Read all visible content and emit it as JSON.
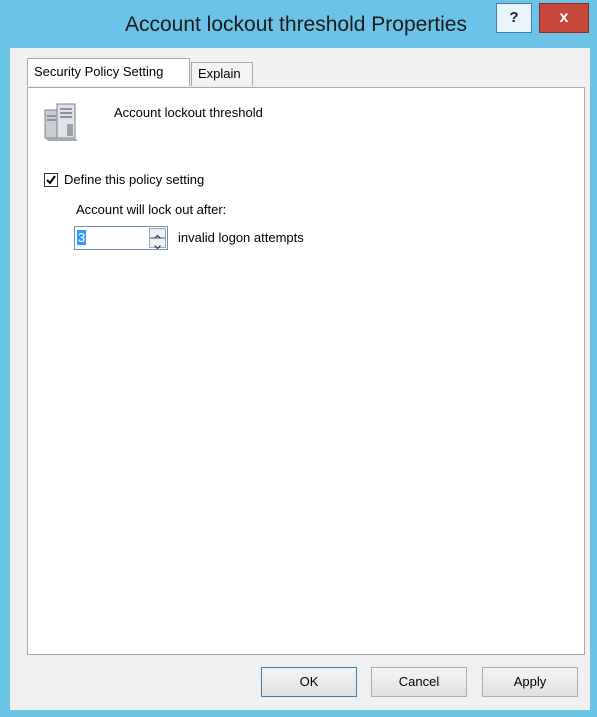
{
  "window": {
    "title": "Account lockout threshold Properties",
    "help_label": "?",
    "close_label": "x"
  },
  "tabs": [
    {
      "label": "Security Policy Setting",
      "active": true
    },
    {
      "label": "Explain",
      "active": false
    }
  ],
  "policy": {
    "icon": "server-policy-icon",
    "name": "Account lockout threshold",
    "define_checkbox_label": "Define this policy setting",
    "define_checked": true,
    "lockout_label": "Account will lock out after:",
    "attempts_value": "3",
    "attempts_suffix": "invalid logon attempts"
  },
  "buttons": {
    "ok": "OK",
    "cancel": "Cancel",
    "apply": "Apply"
  },
  "colors": {
    "frame": "#6cc3e8",
    "close_button": "#c7463a",
    "selection": "#3399ff"
  }
}
